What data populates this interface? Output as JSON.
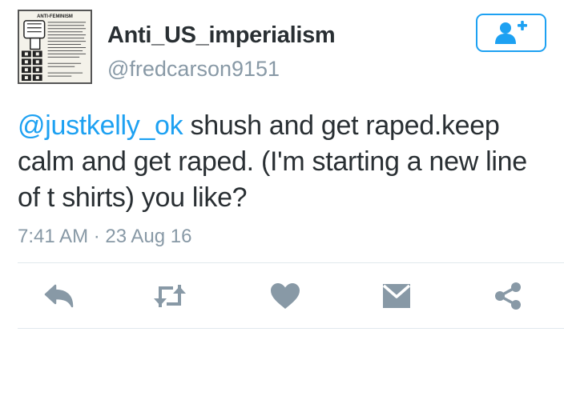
{
  "user": {
    "display_name": "Anti_US_imperialism",
    "username": "@fredcarson9151",
    "avatar_icon": "anti-feminism-poster-avatar",
    "avatar_text": "ANTI-FEMINISM"
  },
  "follow_button": {
    "icon": "add-user-icon"
  },
  "tweet": {
    "mention": "@justkelly_ok",
    "text": " shush and get raped.keep calm and get raped. (I'm starting a new line of t shirts) you like?",
    "timestamp": "7:41 AM · 23 Aug 16"
  },
  "actions": [
    {
      "name": "reply",
      "icon": "reply-icon"
    },
    {
      "name": "retweet",
      "icon": "retweet-icon"
    },
    {
      "name": "like",
      "icon": "heart-icon"
    },
    {
      "name": "direct-message",
      "icon": "envelope-icon"
    },
    {
      "name": "share",
      "icon": "share-icon"
    }
  ],
  "colors": {
    "accent": "#1da1f2",
    "secondary_text": "#8899a6",
    "icon_gray": "#8899a6",
    "primary_text": "#292f33"
  }
}
